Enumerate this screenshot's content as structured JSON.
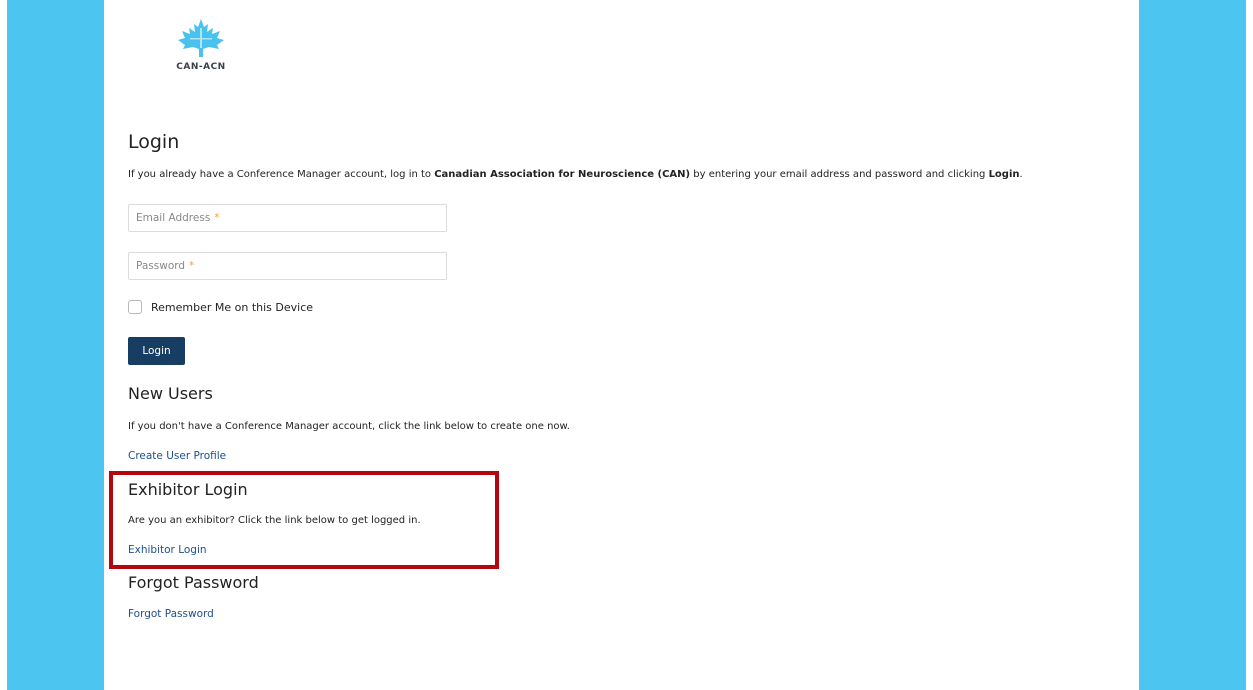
{
  "brand": {
    "logo_text": "CAN-ACN",
    "logo_icon": "maple-leaf-icon",
    "accent_color": "#4cc6f1"
  },
  "login": {
    "title": "Login",
    "intro": {
      "part1": "If you already have a Conference Manager account, log in to ",
      "org": "Canadian Association for Neuroscience (CAN)",
      "part2": " by entering your email address and password and clicking ",
      "action": "Login",
      "part3": "."
    },
    "email": {
      "placeholder": "Email Address",
      "required_mark": "*",
      "value": ""
    },
    "password": {
      "placeholder": "Password",
      "required_mark": "*",
      "value": ""
    },
    "remember_label": "Remember Me on this Device",
    "remember_checked": false,
    "button_label": "Login",
    "button_color": "#173d63"
  },
  "new_users": {
    "title": "New Users",
    "text": "If you don't have a Conference Manager account, click the link below to create one now.",
    "link": "Create User Profile"
  },
  "exhibitor": {
    "title": "Exhibitor Login",
    "text": "Are you an exhibitor? Click the link below to get logged in.",
    "link": "Exhibitor Login",
    "highlight_color": "#b3060d"
  },
  "forgot": {
    "title": "Forgot Password",
    "link": "Forgot Password"
  }
}
